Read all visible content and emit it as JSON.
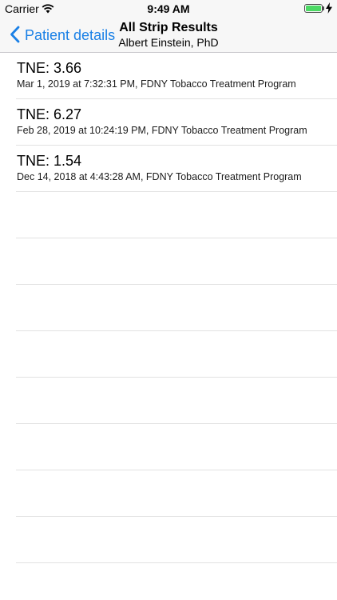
{
  "status_bar": {
    "carrier": "Carrier",
    "time": "9:49 AM",
    "battery_color": "#4cd964"
  },
  "nav": {
    "back_label": "Patient details",
    "title": "All Strip Results",
    "subtitle": "Albert Einstein, PhD",
    "tint_color": "#1a80e6"
  },
  "results": [
    {
      "title": "TNE: 3.66",
      "subtitle": "Mar 1, 2019 at 7:32:31 PM, FDNY Tobacco Treatment Program"
    },
    {
      "title": "TNE: 6.27",
      "subtitle": "Feb 28, 2019 at 10:24:19 PM, FDNY Tobacco Treatment Program"
    },
    {
      "title": "TNE: 1.54",
      "subtitle": "Dec 14, 2018 at 4:43:28 AM, FDNY Tobacco Treatment Program"
    }
  ]
}
